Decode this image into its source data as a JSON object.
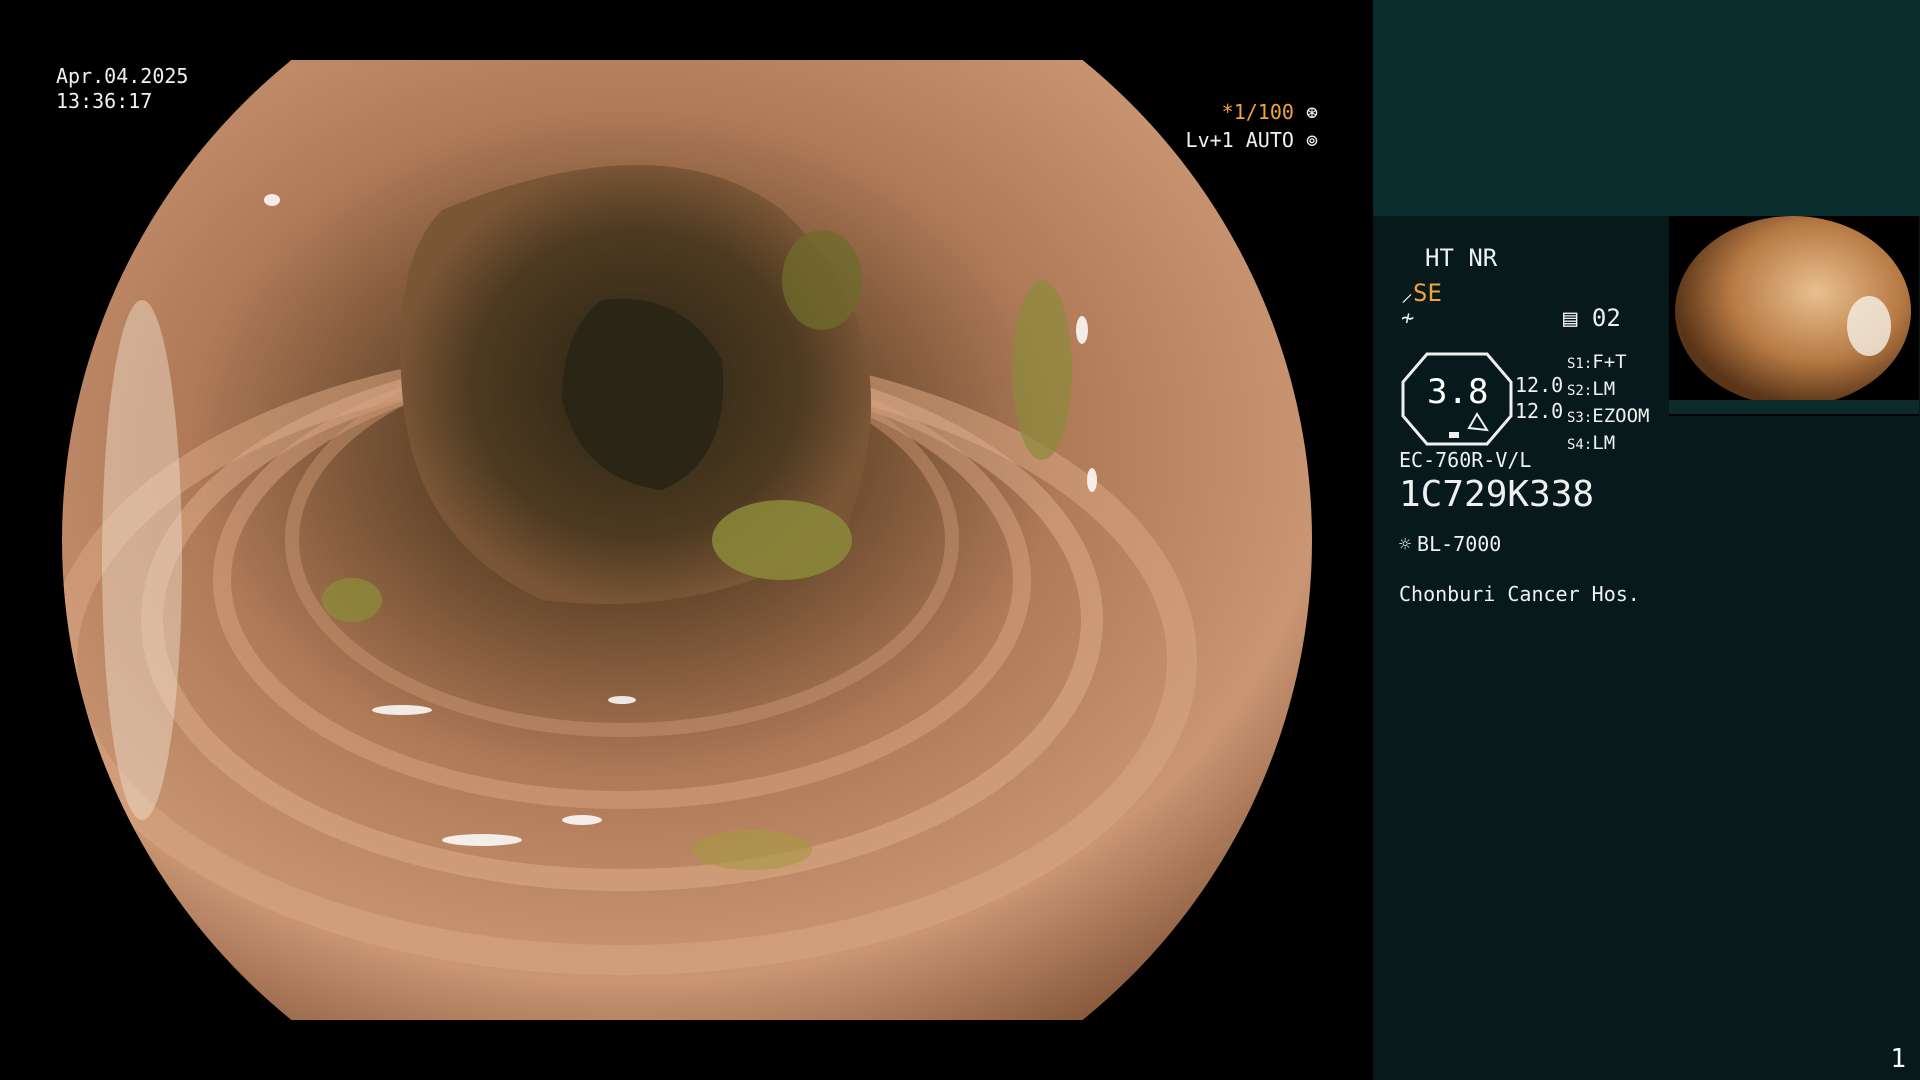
{
  "overlay": {
    "date": "Apr.04.2025",
    "time": "13:36:17",
    "shutter": "*1/100",
    "shutter_icon": "aperture-icon",
    "auto_level": "Lv+1 AUTO",
    "auto_icon": "iris-icon"
  },
  "panel": {
    "ht_nr": "HT NR",
    "se": "SE",
    "memory": "02",
    "gauge_value": "3.8",
    "num_top": "12.0",
    "num_bottom": "12.0",
    "slots": [
      {
        "key": "S1:",
        "val": "F+T"
      },
      {
        "key": "S2:",
        "val": "LM"
      },
      {
        "key": "S3:",
        "val": "EZOOM"
      },
      {
        "key": "S4:",
        "val": "LM"
      }
    ],
    "scope_model": "EC-760R-V/L",
    "scope_serial": "1C729K338",
    "light_source": "BL-7000",
    "hospital": "Chonburi Cancer Hos.",
    "page_number": "1"
  },
  "colors": {
    "accent_orange": "#f2a23a",
    "panel_bg": "#07191a",
    "panel_top": "#0a2d2e"
  }
}
